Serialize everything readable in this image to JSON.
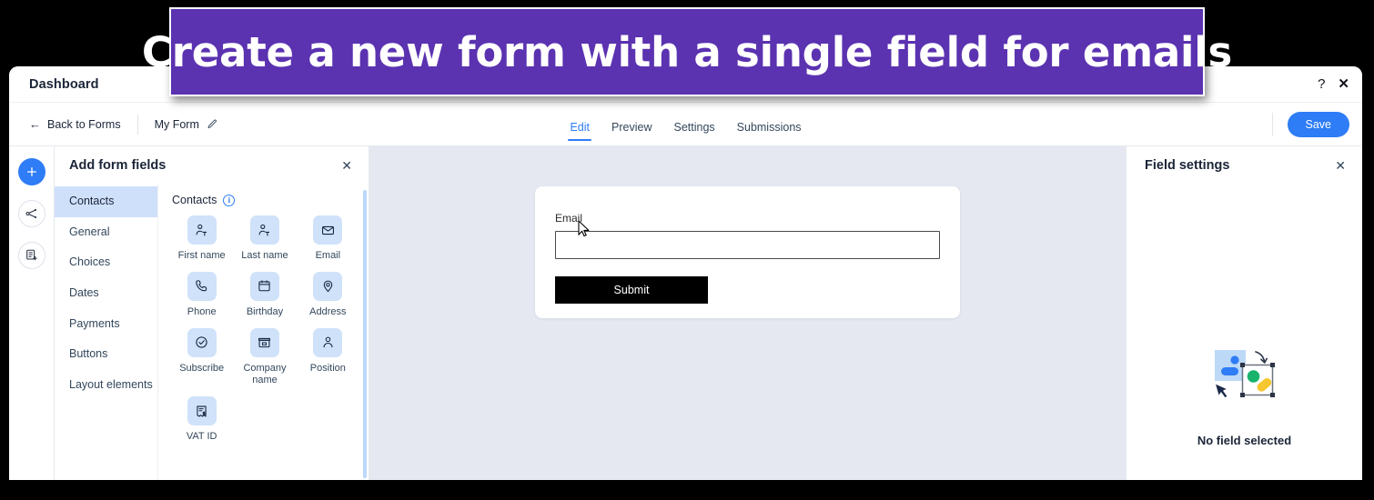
{
  "banner": {
    "text": "Create a new form with a single field for emails",
    "bg_color": "#5b32b0",
    "text_color": "#ffffff"
  },
  "window": {
    "title": "Dashboard",
    "help_icon": "?",
    "close_icon": "✕"
  },
  "toolbar": {
    "back_label": "Back to Forms",
    "back_arrow": "←",
    "form_name": "My Form",
    "edit_pencil_icon": "pencil-icon",
    "tabs": [
      {
        "label": "Edit",
        "active": true
      },
      {
        "label": "Preview",
        "active": false
      },
      {
        "label": "Settings",
        "active": false
      },
      {
        "label": "Submissions",
        "active": false
      }
    ],
    "save_label": "Save",
    "save_color": "#2e7cf6"
  },
  "rail": {
    "items": [
      {
        "name": "add-icon",
        "glyph": "+"
      },
      {
        "name": "branch-icon",
        "glyph": ""
      },
      {
        "name": "document-add-icon",
        "glyph": ""
      }
    ]
  },
  "fields_panel": {
    "title": "Add form fields",
    "close_icon": "✕",
    "categories": [
      {
        "label": "Contacts",
        "active": true
      },
      {
        "label": "General",
        "active": false
      },
      {
        "label": "Choices",
        "active": false
      },
      {
        "label": "Dates",
        "active": false
      },
      {
        "label": "Payments",
        "active": false
      },
      {
        "label": "Buttons",
        "active": false
      },
      {
        "label": "Layout elements",
        "active": false
      }
    ],
    "group_title": "Contacts",
    "group_info_icon": "i",
    "fields": [
      {
        "label": "First name",
        "icon": "person-text-icon"
      },
      {
        "label": "Last name",
        "icon": "person-text-icon"
      },
      {
        "label": "Email",
        "icon": "envelope-icon"
      },
      {
        "label": "Phone",
        "icon": "phone-icon"
      },
      {
        "label": "Birthday",
        "icon": "calendar-icon"
      },
      {
        "label": "Address",
        "icon": "map-pin-icon"
      },
      {
        "label": "Subscribe",
        "icon": "check-circle-icon"
      },
      {
        "label": "Company name",
        "icon": "storefront-icon"
      },
      {
        "label": "Position",
        "icon": "person-icon"
      },
      {
        "label": "VAT ID",
        "icon": "receipt-dollar-icon"
      }
    ]
  },
  "canvas": {
    "background_color": "#e5e8f0",
    "form": {
      "field_label": "Email",
      "field_value": "",
      "field_placeholder": "",
      "submit_label": "Submit",
      "submit_color": "#000000"
    },
    "cursor": "arrow-cursor"
  },
  "settings_panel": {
    "title": "Field settings",
    "close_icon": "✕",
    "empty_state_text": "No field selected",
    "empty_state_illustration": "drag-field-illustration"
  }
}
